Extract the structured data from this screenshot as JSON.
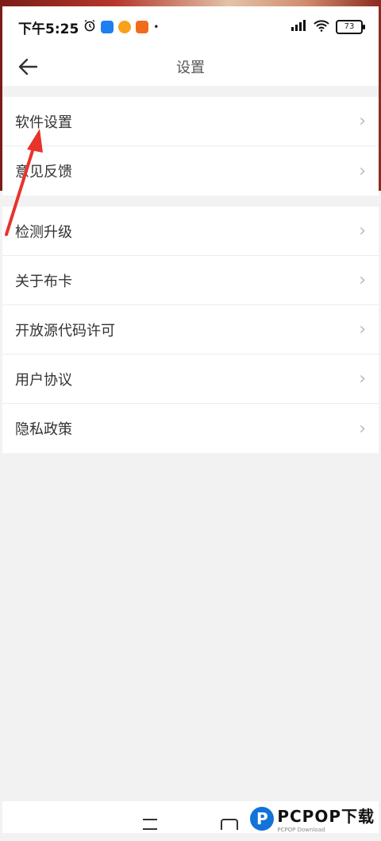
{
  "status_bar": {
    "time": "下午5:25",
    "battery": "73"
  },
  "header": {
    "title": "设置"
  },
  "sections": [
    {
      "items": [
        {
          "label": "软件设置"
        },
        {
          "label": "意见反馈"
        }
      ]
    },
    {
      "items": [
        {
          "label": "检测升级"
        },
        {
          "label": "关于布卡"
        },
        {
          "label": "开放源代码许可"
        },
        {
          "label": "用户协议"
        },
        {
          "label": "隐私政策"
        }
      ]
    }
  ],
  "watermark": {
    "brand": "PCPOP下载",
    "sub": "PCPOP Download",
    "logo_letter": "P"
  },
  "colors": {
    "annotation_arrow": "#e8332a",
    "watermark_blue": "#1273d9"
  }
}
